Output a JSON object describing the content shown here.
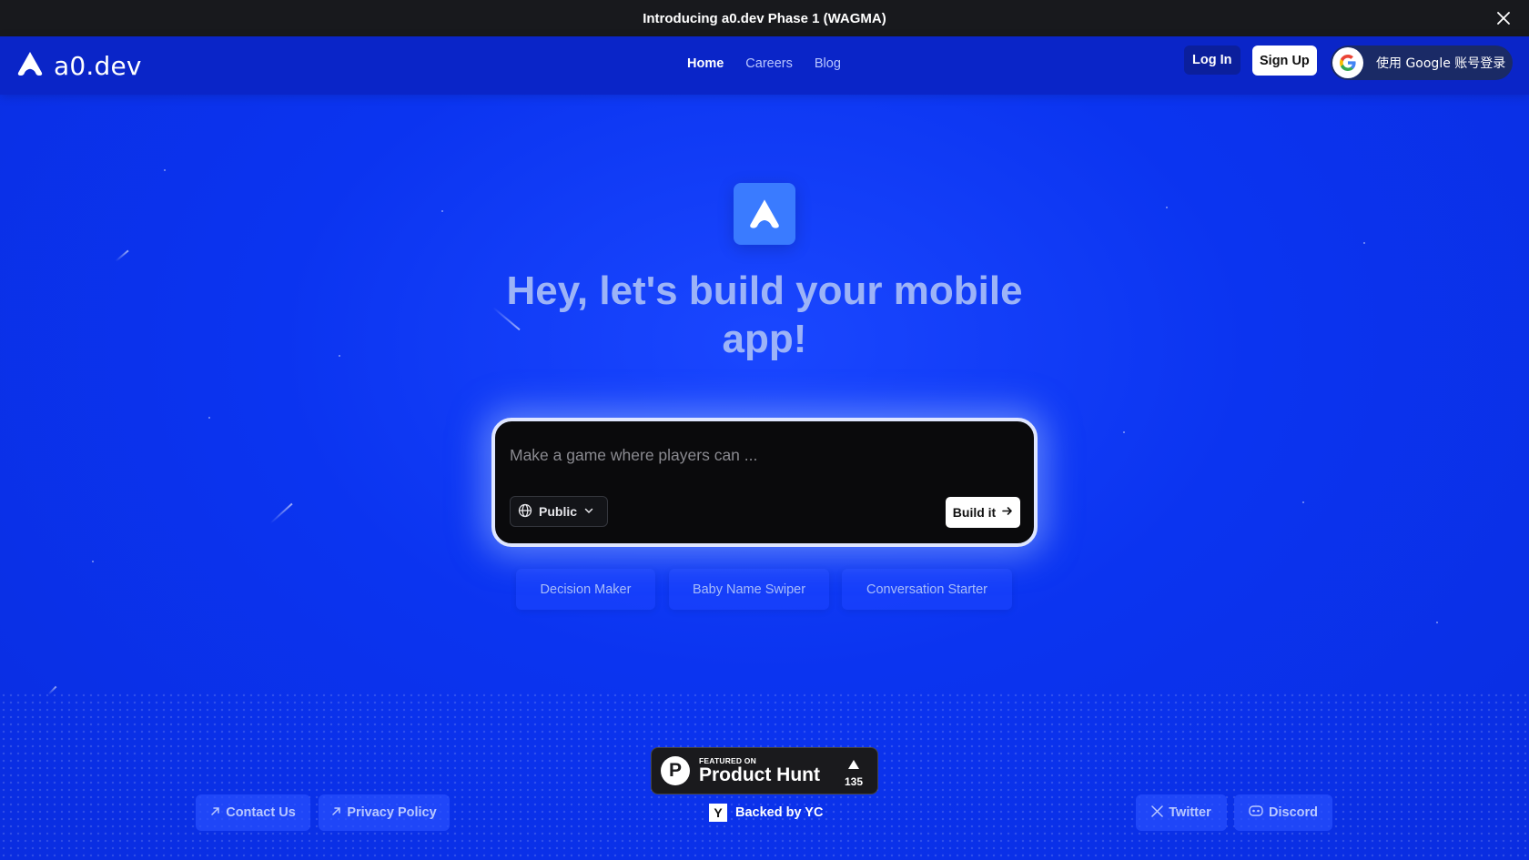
{
  "announcement": {
    "text": "Introducing a0.dev Phase 1 (WAGMA)"
  },
  "brand": {
    "name": "a0.dev"
  },
  "nav": {
    "links": [
      {
        "label": "Home",
        "active": true
      },
      {
        "label": "Careers",
        "active": false
      },
      {
        "label": "Blog",
        "active": false
      }
    ],
    "login_label": "Log In",
    "signup_label": "Sign Up",
    "google_label": "使用 Google 账号登录"
  },
  "hero": {
    "title": "Hey, let's build your mobile app!"
  },
  "prompt": {
    "placeholder": "Make a game where players can ...",
    "visibility": "Public",
    "build_label": "Build it"
  },
  "suggestions": [
    "Decision Maker",
    "Baby Name Swiper",
    "Conversation Starter"
  ],
  "product_hunt": {
    "featured": "FEATURED ON",
    "name": "Product Hunt",
    "votes": "135"
  },
  "backed_by": {
    "letter": "Y",
    "label": "Backed by YC"
  },
  "footer": {
    "contact_label": "Contact Us",
    "privacy_label": "Privacy Policy",
    "twitter_label": "Twitter",
    "discord_label": "Discord"
  },
  "colors": {
    "background": "#0a30e6",
    "nav": "#0a25c8",
    "announcement_bar": "#18191d",
    "app_icon": "#3a7bff",
    "hero_text": "#9cb3f7"
  }
}
